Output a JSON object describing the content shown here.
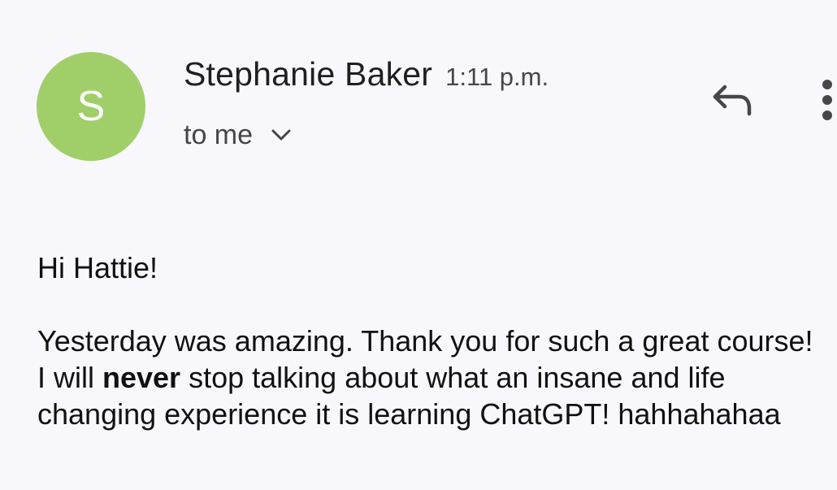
{
  "email": {
    "sender": {
      "initial": "S",
      "name": "Stephanie Baker",
      "time": "1:11 p.m.",
      "avatar_color": "#a0cf6a"
    },
    "recipient_label": "to me",
    "icons": {
      "expand": "chevron-down-icon",
      "reply": "reply-icon",
      "more": "more-vert-icon"
    },
    "body": {
      "greeting": "Hi Hattie!",
      "paragraph_before_bold": "Yesterday was amazing. Thank you for such a great course!   I will ",
      "bold_word": "never",
      "paragraph_after_bold": " stop talking about what an insane and life changing experience it is learning ChatGPT! hahhahahaa"
    }
  }
}
